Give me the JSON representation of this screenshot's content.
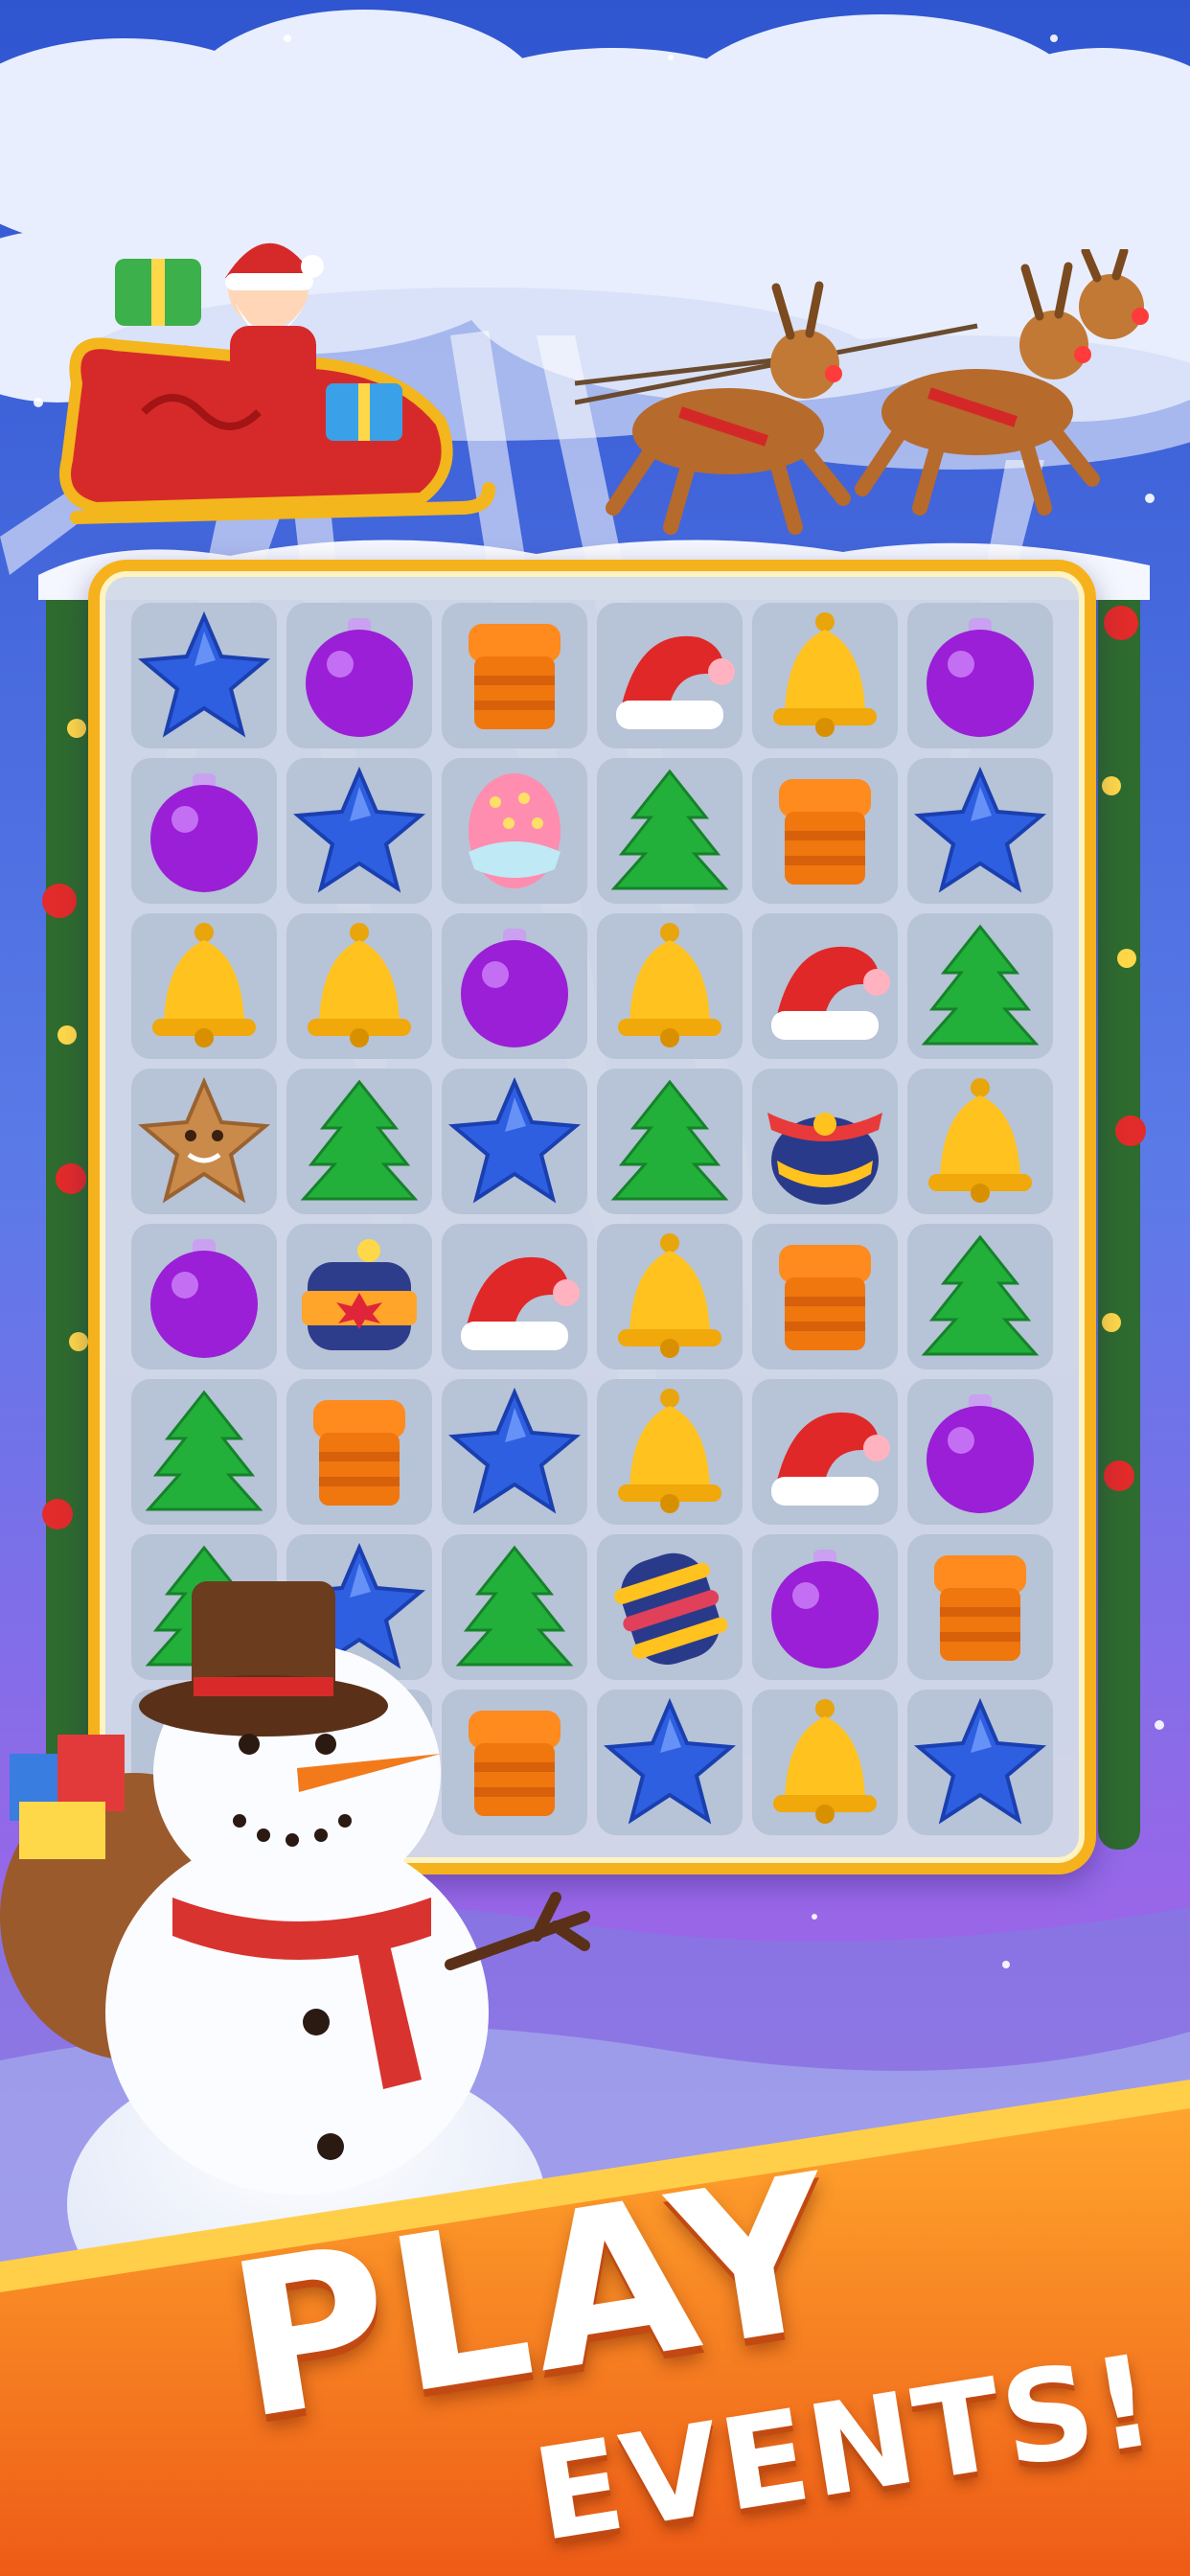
{
  "colors": {
    "sky_top": "#3a5fd6",
    "sky_bottom": "#8a5ee8",
    "board_frame": "#f6b21c",
    "banner": "#f27a1a",
    "banner_text": "#ffffff"
  },
  "banner": {
    "line1": "PLAY",
    "line2": "EVENTS!"
  },
  "board": {
    "columns": 6,
    "rows": 8,
    "cells": [
      [
        "blue-star",
        "purple-ornament",
        "orange-scarf",
        "red-santa-hat",
        "yellow-bell",
        "purple-ornament"
      ],
      [
        "purple-ornament",
        "blue-star",
        "decorated-egg",
        "green-tree",
        "orange-scarf",
        "blue-star"
      ],
      [
        "yellow-bell",
        "yellow-bell",
        "purple-ornament",
        "yellow-bell",
        "red-santa-hat",
        "green-tree"
      ],
      [
        "gingerbread-star",
        "green-tree",
        "blue-star",
        "green-tree",
        "propeller-booster",
        "yellow-bell"
      ],
      [
        "purple-ornament",
        "firecracker-booster",
        "red-santa-hat",
        "yellow-bell",
        "orange-scarf",
        "green-tree"
      ],
      [
        "green-tree",
        "orange-scarf",
        "blue-star",
        "yellow-bell",
        "red-santa-hat",
        "purple-ornament"
      ],
      [
        "green-tree",
        "blue-star",
        "green-tree",
        "rocket-booster",
        "purple-ornament",
        "orange-scarf"
      ],
      [
        "",
        "",
        "orange-scarf",
        "blue-star",
        "yellow-bell",
        "blue-star"
      ]
    ]
  },
  "characters": [
    "santa-sleigh",
    "reindeer-team",
    "snowman-with-gift-sack"
  ]
}
